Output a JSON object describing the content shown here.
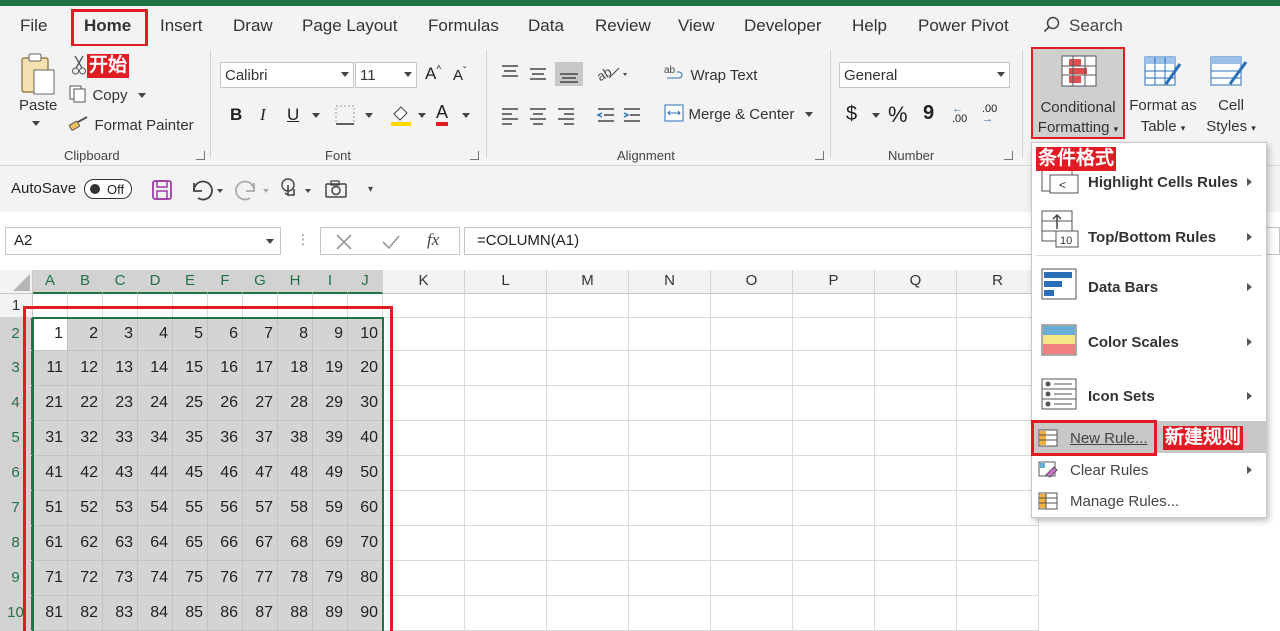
{
  "tabs": [
    "File",
    "Home",
    "Insert",
    "Draw",
    "Page Layout",
    "Formulas",
    "Data",
    "Review",
    "View",
    "Developer",
    "Help",
    "Power Pivot"
  ],
  "search_label": "Search",
  "clipboard": {
    "paste": "Paste",
    "cut_annotation": "开始",
    "copy": "Copy",
    "format_painter": "Format Painter",
    "group": "Clipboard"
  },
  "font": {
    "name": "Calibri",
    "size": "11",
    "bold": "B",
    "italic": "I",
    "underline": "U",
    "grow": "A",
    "shrink": "A",
    "color_letter": "A",
    "group": "Font"
  },
  "alignment": {
    "wrap_text": "Wrap Text",
    "merge_center": "Merge & Center",
    "group": "Alignment"
  },
  "number": {
    "format": "General",
    "currency": "$",
    "percent": "%",
    "comma": "9",
    "inc_decimal": ".00",
    "dec_decimal": ".00",
    "group": "Number"
  },
  "styles": {
    "cf_line1": "Conditional",
    "cf_line2": "Formatting",
    "fat_line1": "Format as",
    "fat_line2": "Table",
    "cs_line1": "Cell",
    "cs_line2": "Styles"
  },
  "annotations": {
    "home": "开始",
    "conditional_formatting": "条件格式",
    "new_rule": "新建规则"
  },
  "qat": {
    "autosave": "AutoSave",
    "toggle": "Off"
  },
  "formula_bar": {
    "name_box": "A2",
    "fx": "fx",
    "formula": "=COLUMN(A1)"
  },
  "columns": [
    "A",
    "B",
    "C",
    "D",
    "E",
    "F",
    "G",
    "H",
    "I",
    "J",
    "K",
    "L",
    "M",
    "N",
    "O",
    "P",
    "Q",
    "R"
  ],
  "rows": [
    "1",
    "2",
    "3",
    "4",
    "5",
    "6",
    "7",
    "8",
    "9",
    "10"
  ],
  "cell_values": [
    [
      "1",
      "2",
      "3",
      "4",
      "5",
      "6",
      "7",
      "8",
      "9",
      "10"
    ],
    [
      "11",
      "12",
      "13",
      "14",
      "15",
      "16",
      "17",
      "18",
      "19",
      "20"
    ],
    [
      "21",
      "22",
      "23",
      "24",
      "25",
      "26",
      "27",
      "28",
      "29",
      "30"
    ],
    [
      "31",
      "32",
      "33",
      "34",
      "35",
      "36",
      "37",
      "38",
      "39",
      "40"
    ],
    [
      "41",
      "42",
      "43",
      "44",
      "45",
      "46",
      "47",
      "48",
      "49",
      "50"
    ],
    [
      "51",
      "52",
      "53",
      "54",
      "55",
      "56",
      "57",
      "58",
      "59",
      "60"
    ],
    [
      "61",
      "62",
      "63",
      "64",
      "65",
      "66",
      "67",
      "68",
      "69",
      "70"
    ],
    [
      "71",
      "72",
      "73",
      "74",
      "75",
      "76",
      "77",
      "78",
      "79",
      "80"
    ],
    [
      "81",
      "82",
      "83",
      "84",
      "85",
      "86",
      "87",
      "88",
      "89",
      "90"
    ]
  ],
  "menu": {
    "highlight": "Highlight Cells Rules",
    "topbottom": "Top/Bottom Rules",
    "databars": "Data Bars",
    "colorscales": "Color Scales",
    "iconsets": "Icon Sets",
    "newrule": "New Rule...",
    "clearrules": "Clear Rules",
    "managerules": "Manage Rules..."
  },
  "colors": {
    "excel_green": "#217346",
    "annotation_red": "#e01b24",
    "selection_gray": "#d4d4d4"
  }
}
